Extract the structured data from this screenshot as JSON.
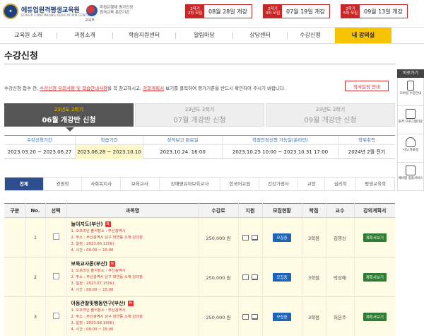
{
  "header": {
    "logo_title": "에듀업원격평생교육원",
    "logo_sub": "EDUUP CONTINUING EDUCATION CENTER",
    "partner_text1": "학점은행제 평가인정",
    "partner_text2": "원격교육 훈련기관",
    "partner_label": "교육부",
    "badges": [
      {
        "tag1": "2학기",
        "tag2": "2차 모집",
        "date": "08월 28일 개강"
      },
      {
        "tag1": "2학기",
        "tag2": "3차 모집",
        "date": "07월 19일 개강"
      },
      {
        "tag1": "2학기",
        "tag2": "5차 모집",
        "date": "09월 13일 개강"
      }
    ]
  },
  "nav": {
    "items": [
      "교육원 소개",
      "과정소개",
      "학습지원센터",
      "알림마당",
      "상담센터",
      "수강신청",
      "내 강의실"
    ],
    "active_index": 6
  },
  "page_title": "수강신청",
  "notice": {
    "part1": "수강신청 접수 전, ",
    "link1": "수강신청 유의사항 및 학습안내사항",
    "part2": "을 꼭 참고하시고, ",
    "link2": "강의계획서",
    "part3": " 보기를 클릭하여 평가기준을 반드시 확인하여 주시기 바랍니다."
  },
  "schedule_button": "학사일정 안내",
  "terms": [
    {
      "year": "23년도 2학기",
      "name": "06월 개강반 신청",
      "active": true
    },
    {
      "year": "23년도 2학기",
      "name": "07월 개강반 신청",
      "active": false
    },
    {
      "year": "23년도 2학기",
      "name": "09월 개강반 신청",
      "active": false
    }
  ],
  "periods": [
    {
      "label": "수강신청기간",
      "value": "2023.03.20 ~ 2023.06.27"
    },
    {
      "label": "학습기간",
      "value": "2023.06.28 ~ 2023.10.10"
    },
    {
      "label": "성적보고 완료일",
      "value": "2023.10.24. 16:00"
    },
    {
      "label": "학점인정신청 가능일(온라인)",
      "value": "2023.10.25 10:00 ~ 2023.10.31 17:00"
    },
    {
      "label": "학위취득",
      "value": "2024년 2월 전기"
    }
  ],
  "categories": {
    "items": [
      "전체",
      "경영학",
      "사회복지사",
      "보육교사",
      "장애영유아보육교사",
      "한국어교원",
      "건강가정사",
      "교양",
      "심리학",
      "평생교육학"
    ],
    "active_index": 0
  },
  "table": {
    "headers": [
      "구분",
      "No.",
      "선택",
      "과목명",
      "수강료",
      "지원",
      "모집현황",
      "학점",
      "교수",
      "강의계획서"
    ],
    "rows": [
      {
        "no": "1",
        "course": "놀이지도(부산)",
        "badge": "N",
        "details": [
          "1. 오프라인 출석장소 : 부산광역시",
          "2. 주소 : 부산광역시 남구 대연동 소재 강의장",
          "3. 일정 : 2023.06.12(토)",
          "4. 시간 : 09:00 ~ 15:00"
        ],
        "fee": "250,000 원",
        "status": "모집중",
        "credit": "3학점",
        "professor": "김영신",
        "plan": "계획서보기"
      },
      {
        "no": "2",
        "course": "보육교사론(부산)",
        "badge": "N",
        "details": [
          "1. 오프라인 출석장소 : 부산광역시",
          "2. 주소 : 부산광역시 남구 대연동 소재 강의장",
          "3. 일정 : 2023.07.15(토)",
          "4. 시간 : 09:00 ~ 15:00"
        ],
        "fee": "250,000 원",
        "status": "모집중",
        "credit": "3학점",
        "professor": "박상애",
        "plan": "계획서보기"
      },
      {
        "no": "3",
        "course": "아동관찰및행동연구(부산)",
        "badge": "N",
        "details": [
          "1. 오프라인 출석장소 : 부산광역시",
          "2. 주소 : 부산광역시 남구 대연동 소재 강의장",
          "3. 일정 : 2023.08.19(토)",
          "4. 시간 : 09:00 ~ 15:00"
        ],
        "fee": "250,000 원",
        "status": "모집중",
        "credit": "3학점",
        "professor": "허은주",
        "plan": "계획서보기"
      }
    ]
  },
  "quick_menu": {
    "title": "바로가기",
    "items": [
      "모바일 수강안내",
      "원격 프로그램다운",
      "서식 자료실",
      "예비합 종합서비스"
    ]
  }
}
